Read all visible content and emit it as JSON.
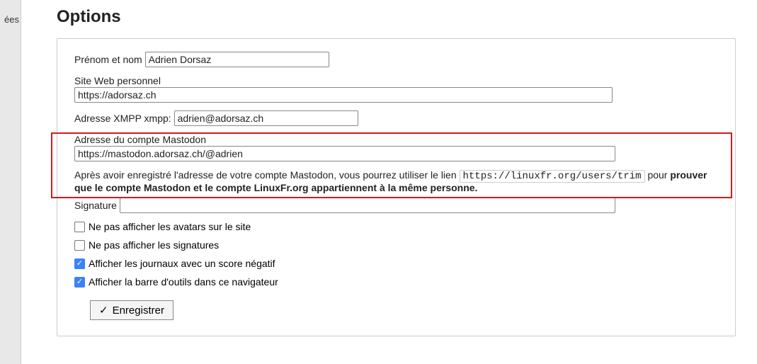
{
  "leftFragment": {
    "line1": "ées"
  },
  "title": "Options",
  "fields": {
    "name": {
      "label": "Prénom et nom",
      "value": "Adrien Dorsaz"
    },
    "website": {
      "label": "Site Web personnel",
      "value": "https://adorsaz.ch"
    },
    "xmpp": {
      "label": "Adresse XMPP xmpp:",
      "value": "adrien@adorsaz.ch"
    },
    "mastodon": {
      "label": "Adresse du compte Mastodon",
      "value": "https://mastodon.adorsaz.ch/@adrien"
    },
    "signature": {
      "label": "Signature",
      "value": ""
    }
  },
  "help": {
    "pre": "Après avoir enregistré l'adresse de votre compte Mastodon, vous pourrez utiliser le lien ",
    "url": "https://linuxfr.org/users/trim",
    "mid": " pour ",
    "bold": "prouver que le compte Mastodon et le compte LinuxFr.org appartiennent à la même personne."
  },
  "checkboxes": {
    "avatars": {
      "checked": false,
      "label": "Ne pas afficher les avatars sur le site"
    },
    "signatures": {
      "checked": false,
      "label": "Ne pas afficher les signatures"
    },
    "journals": {
      "checked": true,
      "label": "Afficher les journaux avec un score négatif"
    },
    "toolbar": {
      "checked": true,
      "label": "Afficher la barre d'outils dans ce navigateur"
    }
  },
  "actions": {
    "save": "Enregistrer"
  }
}
